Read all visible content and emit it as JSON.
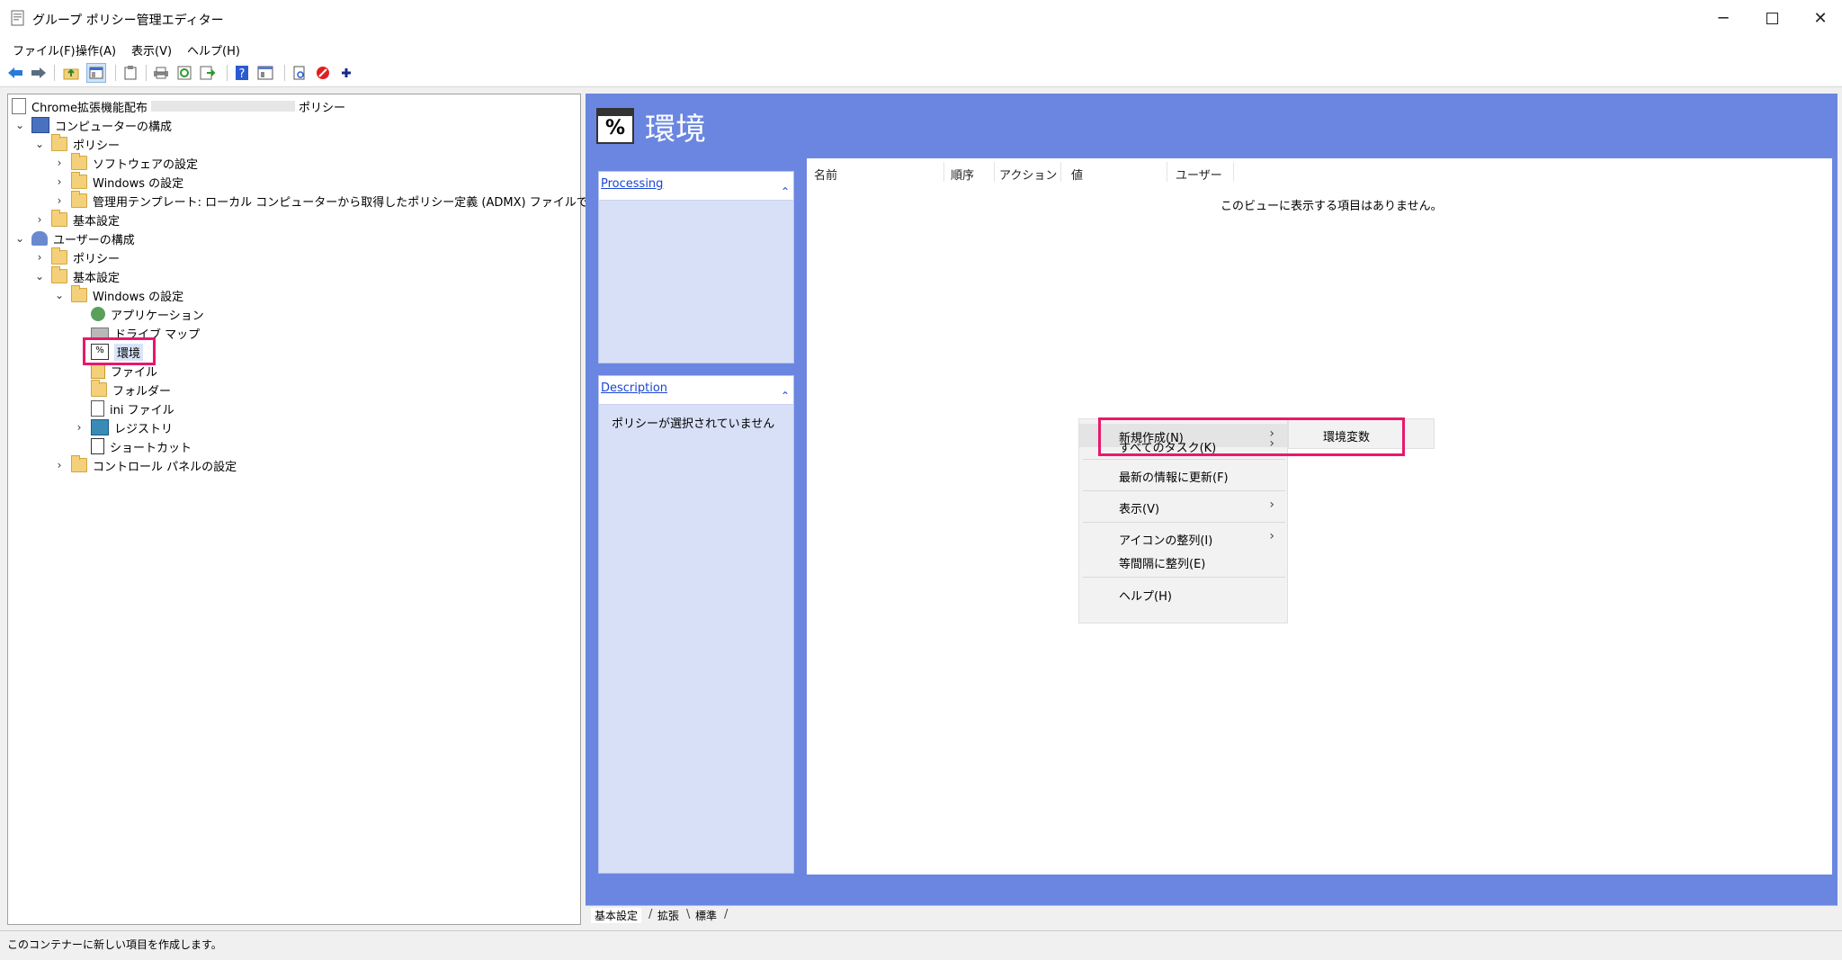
{
  "window": {
    "title": "グループ ポリシー管理エディター"
  },
  "menubar": [
    "ファイル(F)",
    "操作(A)",
    "表示(V)",
    "ヘルプ(H)"
  ],
  "tree": {
    "root_prefix": "Chrome拡張機能配布",
    "root_suffix": "ポリシー",
    "computer": "コンピューターの構成",
    "policy": "ポリシー",
    "software": "ソフトウェアの設定",
    "windows": "Windows の設定",
    "admx": "管理用テンプレート: ローカル コンピューターから取得したポリシー定義 (ADMX) ファイルです。",
    "basic": "基本設定",
    "user": "ユーザーの構成",
    "u_policy": "ポリシー",
    "u_basic": "基本設定",
    "u_windows": "Windows の設定",
    "app": "アプリケーション",
    "drive": "ドライブ マップ",
    "env": "環境",
    "file": "ファイル",
    "folder": "フォルダー",
    "ini": "ini ファイル",
    "registry": "レジストリ",
    "shortcut": "ショートカット",
    "control": "コントロール パネルの設定"
  },
  "header": {
    "title": "環境",
    "icon_text": "%"
  },
  "panels": {
    "processing": "Processing",
    "description": "Description",
    "desc_text": "ポリシーが選択されていません"
  },
  "listview": {
    "columns": [
      "名前",
      "順序",
      "アクション",
      "値",
      "ユーザー"
    ],
    "empty": "このビューに表示する項目はありません。"
  },
  "tabs": [
    "基本設定",
    "拡張",
    "標準"
  ],
  "status": "このコンテナーに新しい項目を作成します。",
  "context_menu": {
    "new": "新規作成(N)",
    "all_tasks": "すべてのタスク(K)",
    "refresh": "最新の情報に更新(F)",
    "view": "表示(V)",
    "arrange": "アイコンの整列(I)",
    "line_up": "等間隔に整列(E)",
    "help": "ヘルプ(H)"
  },
  "submenu": {
    "item": "環境変数"
  },
  "colors": {
    "pane_blue": "#6a86e0",
    "highlight": "#e8186c",
    "link": "#1a46d6"
  }
}
